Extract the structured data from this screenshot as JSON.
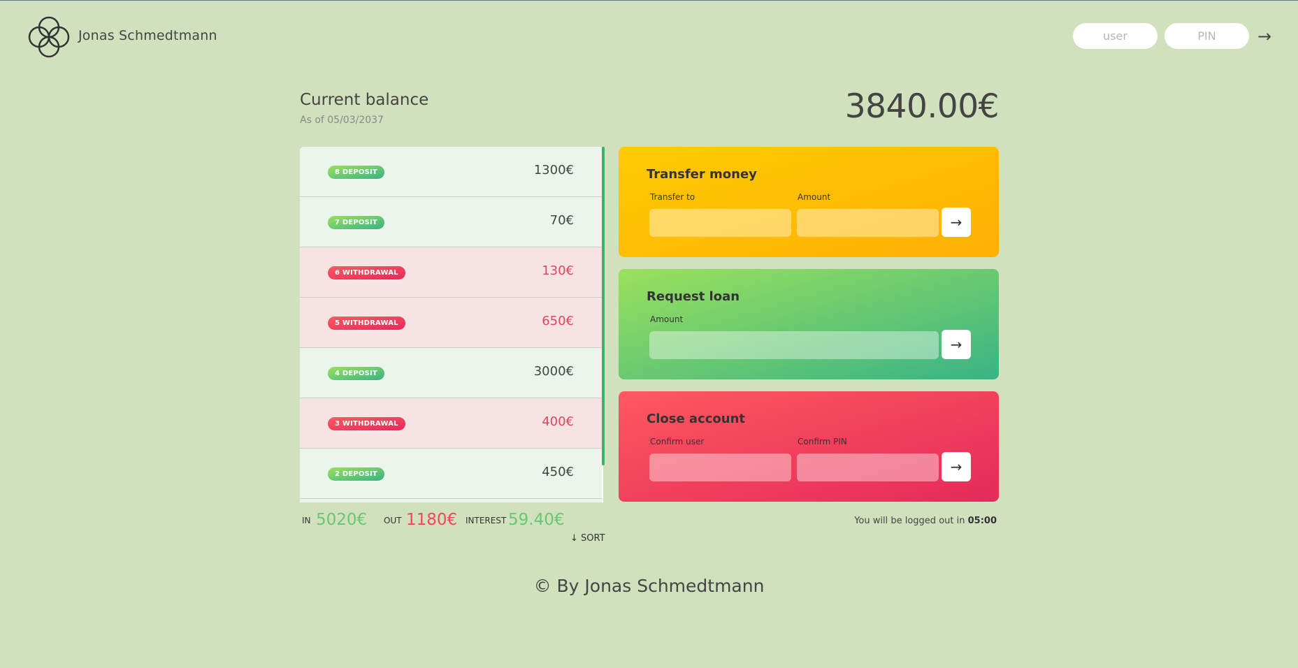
{
  "nav": {
    "welcome": "Jonas Schmedtmann",
    "user_placeholder": "user",
    "pin_placeholder": "PIN",
    "login_arrow": "→",
    "logo_icon": "intertwined-circles-logo-icon"
  },
  "balance": {
    "label": "Current balance",
    "date": "As of 05/03/2037",
    "value": "3840.00€"
  },
  "movements": [
    {
      "type": "deposit",
      "label": "8 DEPOSIT",
      "value": "1300€"
    },
    {
      "type": "deposit",
      "label": "7 DEPOSIT",
      "value": "70€"
    },
    {
      "type": "withdrawal",
      "label": "6 WITHDRAWAL",
      "value": "130€"
    },
    {
      "type": "withdrawal",
      "label": "5 WITHDRAWAL",
      "value": "650€"
    },
    {
      "type": "deposit",
      "label": "4 DEPOSIT",
      "value": "3000€"
    },
    {
      "type": "withdrawal",
      "label": "3 WITHDRAWAL",
      "value": "400€"
    },
    {
      "type": "deposit",
      "label": "2 DEPOSIT",
      "value": "450€"
    }
  ],
  "summary": {
    "in_label": "IN",
    "in_value": "5020€",
    "out_label": "OUT",
    "out_value": "1180€",
    "interest_label": "INTEREST",
    "interest_value": "59.40€",
    "sort_label": "↓ SORT"
  },
  "operations": {
    "transfer": {
      "title": "Transfer money",
      "to_label": "Transfer to",
      "amount_label": "Amount",
      "button": "→"
    },
    "loan": {
      "title": "Request loan",
      "amount_label": "Amount",
      "button": "→"
    },
    "close": {
      "title": "Close account",
      "user_label": "Confirm user",
      "pin_label": "Confirm PIN",
      "button": "→"
    }
  },
  "logout": {
    "text": "You will be logged out in ",
    "time": "05:00"
  },
  "footer": {
    "text": "© By Jonas Schmedtmann"
  },
  "colors": {
    "background": "#d2e1bd",
    "deposit": "#66c873",
    "withdrawal": "#f5465d",
    "transfer": "#ffcb03",
    "loan": "#39b385",
    "close": "#e52a5a"
  }
}
